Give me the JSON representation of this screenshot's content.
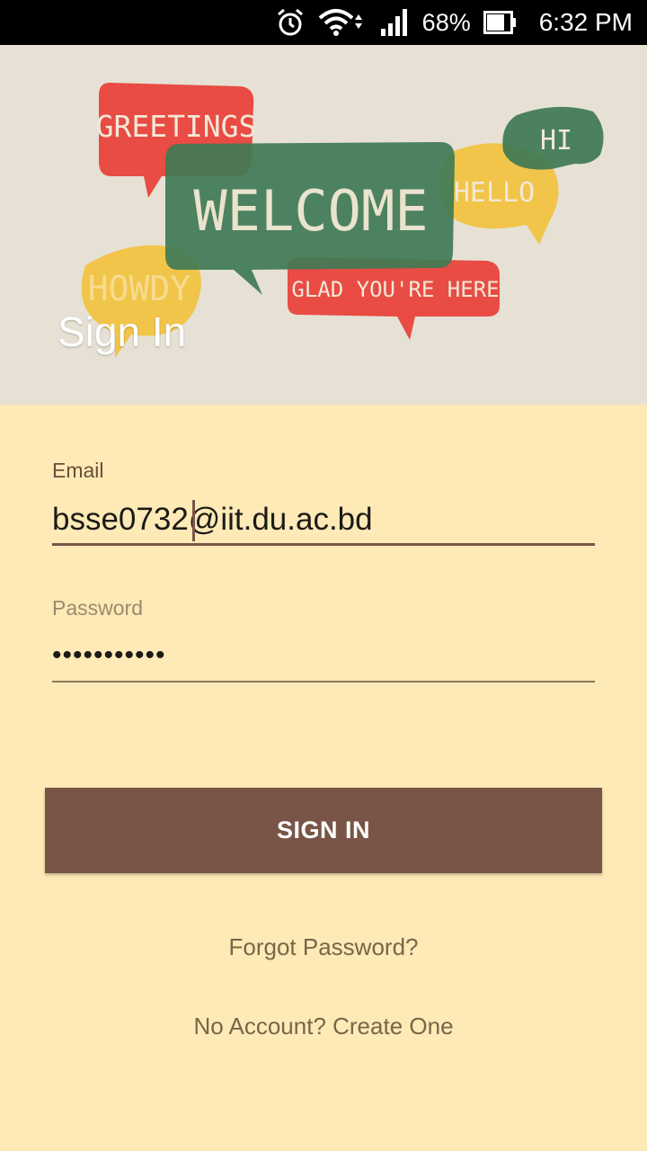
{
  "status_bar": {
    "battery_percent": "68%",
    "time": "6:32 PM",
    "icons": [
      "alarm-icon",
      "wifi-icon",
      "signal-icon",
      "battery-icon"
    ]
  },
  "banner": {
    "bubbles": [
      "GREETINGS",
      "WELCOME",
      "HELLO",
      "HI",
      "HOWDY",
      "GLAD YOU'RE HERE"
    ],
    "title": "Sign In"
  },
  "form": {
    "email_label": "Email",
    "email_value": "bsse0732@iit.du.ac.bd",
    "password_label": "Password",
    "password_value": "•••••••••••"
  },
  "actions": {
    "signin_label": "SIGN IN",
    "forgot_label": "Forgot Password?",
    "create_label": "No Account? Create One"
  },
  "colors": {
    "background": "#fdeab6",
    "primary": "#795548",
    "bubble_red": "#e8433c",
    "bubble_green": "#3f7a55",
    "bubble_yellow": "#f2c23e"
  }
}
